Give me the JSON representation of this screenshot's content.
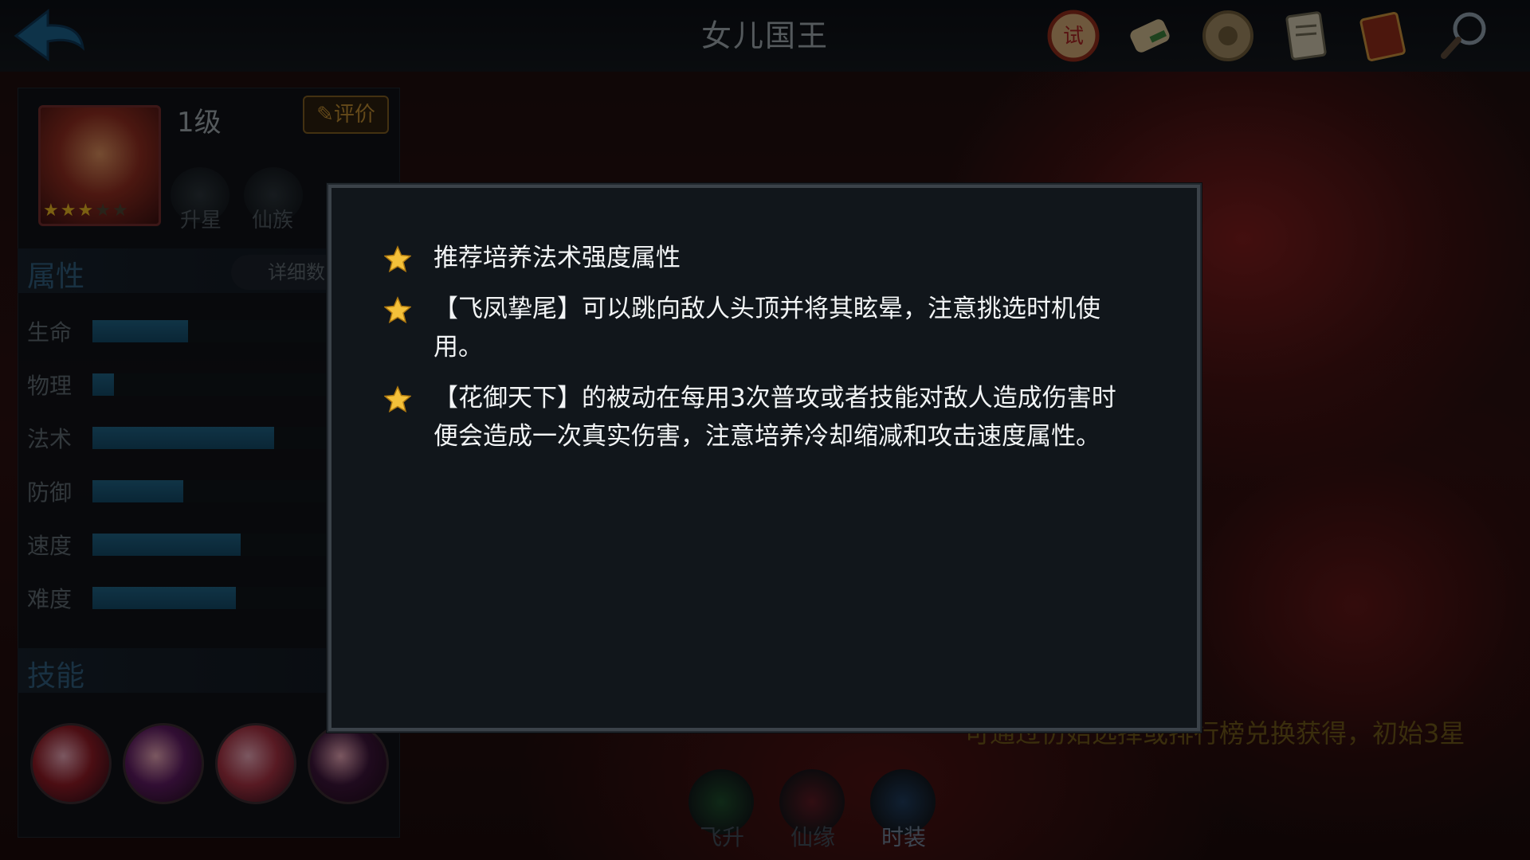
{
  "header": {
    "title": "女儿国王",
    "icons": [
      "trial-seal-icon",
      "scroll-icon",
      "gear-medallion-icon",
      "document-icon",
      "book-icon",
      "magnifier-icon"
    ]
  },
  "hero": {
    "level": "1级",
    "stars": 3,
    "max_stars": 5,
    "rate_label": "评价",
    "actions": [
      "升星",
      "仙族"
    ]
  },
  "attributes": {
    "title": "属性",
    "detail_label": "详细数",
    "stats": [
      {
        "label": "生命",
        "value": 0.4
      },
      {
        "label": "物理",
        "value": 0.09
      },
      {
        "label": "法术",
        "value": 0.76
      },
      {
        "label": "防御",
        "value": 0.38
      },
      {
        "label": "速度",
        "value": 0.62
      },
      {
        "label": "难度",
        "value": 0.6
      }
    ]
  },
  "skills": {
    "title": "技能",
    "colors": [
      "#8a1a24",
      "#5a1a5e",
      "#a03040",
      "#3a1438"
    ]
  },
  "bottom_tabs": [
    {
      "label": "飞升",
      "color": "#1d4a2a"
    },
    {
      "label": "仙缘",
      "color": "#5a1a22"
    },
    {
      "label": "时装",
      "color": "#1f3a5a"
    }
  ],
  "hint": "可通过仿始选择或排行榜兑换获得，初始3星",
  "tips": [
    "推荐培养法术强度属性",
    "【飞凤挚尾】可以跳向敌人头顶并将其眩晕，注意挑选时机使用。",
    "【花御天下】的被动在每用3次普攻或者技能对敌人造成伤害时便会造成一次真实伤害，注意培养冷却缩减和攻击速度属性。"
  ],
  "colors": {
    "accent_blue": "#1f5f80",
    "star_gold": "#e1b021",
    "modal_bg": "#11161b"
  }
}
